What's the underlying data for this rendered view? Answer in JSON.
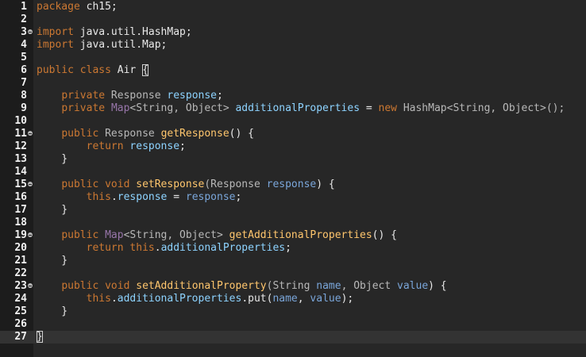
{
  "colors": {
    "background": "#272727",
    "gutter": "#1c1c1c",
    "current_line": "#333333",
    "keyword": "#cc7832",
    "method": "#ffc66d",
    "field": "#8dd3ff",
    "parameter": "#7aa6da",
    "interface_type": "#9876aa"
  },
  "fold_icon": "fold-collapse-icon",
  "current_line": 27,
  "lines": [
    {
      "num": "1",
      "fold": false,
      "tokens": [
        {
          "t": "package",
          "c": "kw"
        },
        {
          "t": " ch15;",
          "c": "plain"
        }
      ]
    },
    {
      "num": "2",
      "fold": false,
      "tokens": []
    },
    {
      "num": "3",
      "fold": true,
      "tokens": [
        {
          "t": "import",
          "c": "kw"
        },
        {
          "t": " java.util.HashMap;",
          "c": "plain"
        }
      ]
    },
    {
      "num": "4",
      "fold": false,
      "tokens": [
        {
          "t": "import",
          "c": "kw"
        },
        {
          "t": " java.util.Map;",
          "c": "plain"
        }
      ]
    },
    {
      "num": "5",
      "fold": false,
      "tokens": []
    },
    {
      "num": "6",
      "fold": false,
      "tokens": [
        {
          "t": "public",
          "c": "kw"
        },
        {
          "t": " ",
          "c": "plain"
        },
        {
          "t": "class",
          "c": "kw"
        },
        {
          "t": " Air ",
          "c": "plain"
        },
        {
          "t": "{",
          "c": "bracket"
        }
      ]
    },
    {
      "num": "7",
      "fold": false,
      "tokens": []
    },
    {
      "num": "8",
      "fold": false,
      "tokens": [
        {
          "t": "    ",
          "c": "plain"
        },
        {
          "t": "private",
          "c": "kw"
        },
        {
          "t": " Response ",
          "c": "type"
        },
        {
          "t": "response",
          "c": "field"
        },
        {
          "t": ";",
          "c": "plain"
        }
      ]
    },
    {
      "num": "9",
      "fold": false,
      "tokens": [
        {
          "t": "    ",
          "c": "plain"
        },
        {
          "t": "private",
          "c": "kw"
        },
        {
          "t": " ",
          "c": "plain"
        },
        {
          "t": "Map",
          "c": "iface"
        },
        {
          "t": "<String, Object> ",
          "c": "type"
        },
        {
          "t": "additionalProperties",
          "c": "field"
        },
        {
          "t": " = ",
          "c": "plain"
        },
        {
          "t": "new",
          "c": "kw"
        },
        {
          "t": " HashMap<String, Object>();",
          "c": "type"
        }
      ]
    },
    {
      "num": "10",
      "fold": false,
      "tokens": []
    },
    {
      "num": "11",
      "fold": true,
      "tokens": [
        {
          "t": "    ",
          "c": "plain"
        },
        {
          "t": "public",
          "c": "kw"
        },
        {
          "t": " Response ",
          "c": "type"
        },
        {
          "t": "getResponse",
          "c": "method"
        },
        {
          "t": "() {",
          "c": "plain"
        }
      ]
    },
    {
      "num": "12",
      "fold": false,
      "tokens": [
        {
          "t": "        ",
          "c": "plain"
        },
        {
          "t": "return",
          "c": "kw"
        },
        {
          "t": " ",
          "c": "plain"
        },
        {
          "t": "response",
          "c": "field"
        },
        {
          "t": ";",
          "c": "plain"
        }
      ]
    },
    {
      "num": "13",
      "fold": false,
      "tokens": [
        {
          "t": "    }",
          "c": "plain"
        }
      ]
    },
    {
      "num": "14",
      "fold": false,
      "tokens": []
    },
    {
      "num": "15",
      "fold": true,
      "tokens": [
        {
          "t": "    ",
          "c": "plain"
        },
        {
          "t": "public",
          "c": "kw"
        },
        {
          "t": " ",
          "c": "plain"
        },
        {
          "t": "void",
          "c": "kw"
        },
        {
          "t": " ",
          "c": "plain"
        },
        {
          "t": "setResponse",
          "c": "method"
        },
        {
          "t": "(Response ",
          "c": "type"
        },
        {
          "t": "response",
          "c": "param"
        },
        {
          "t": ") {",
          "c": "plain"
        }
      ]
    },
    {
      "num": "16",
      "fold": false,
      "tokens": [
        {
          "t": "        ",
          "c": "plain"
        },
        {
          "t": "this",
          "c": "kw"
        },
        {
          "t": ".",
          "c": "plain"
        },
        {
          "t": "response",
          "c": "field"
        },
        {
          "t": " = ",
          "c": "plain"
        },
        {
          "t": "response",
          "c": "param"
        },
        {
          "t": ";",
          "c": "plain"
        }
      ]
    },
    {
      "num": "17",
      "fold": false,
      "tokens": [
        {
          "t": "    }",
          "c": "plain"
        }
      ]
    },
    {
      "num": "18",
      "fold": false,
      "tokens": []
    },
    {
      "num": "19",
      "fold": true,
      "tokens": [
        {
          "t": "    ",
          "c": "plain"
        },
        {
          "t": "public",
          "c": "kw"
        },
        {
          "t": " ",
          "c": "plain"
        },
        {
          "t": "Map",
          "c": "iface"
        },
        {
          "t": "<String, Object> ",
          "c": "type"
        },
        {
          "t": "getAdditionalProperties",
          "c": "method"
        },
        {
          "t": "() {",
          "c": "plain"
        }
      ]
    },
    {
      "num": "20",
      "fold": false,
      "tokens": [
        {
          "t": "        ",
          "c": "plain"
        },
        {
          "t": "return",
          "c": "kw"
        },
        {
          "t": " ",
          "c": "plain"
        },
        {
          "t": "this",
          "c": "kw"
        },
        {
          "t": ".",
          "c": "plain"
        },
        {
          "t": "additionalProperties",
          "c": "field"
        },
        {
          "t": ";",
          "c": "plain"
        }
      ]
    },
    {
      "num": "21",
      "fold": false,
      "tokens": [
        {
          "t": "    }",
          "c": "plain"
        }
      ]
    },
    {
      "num": "22",
      "fold": false,
      "tokens": []
    },
    {
      "num": "23",
      "fold": true,
      "tokens": [
        {
          "t": "    ",
          "c": "plain"
        },
        {
          "t": "public",
          "c": "kw"
        },
        {
          "t": " ",
          "c": "plain"
        },
        {
          "t": "void",
          "c": "kw"
        },
        {
          "t": " ",
          "c": "plain"
        },
        {
          "t": "setAdditionalProperty",
          "c": "method"
        },
        {
          "t": "(String ",
          "c": "type"
        },
        {
          "t": "name",
          "c": "param"
        },
        {
          "t": ", Object ",
          "c": "type"
        },
        {
          "t": "value",
          "c": "param"
        },
        {
          "t": ") {",
          "c": "plain"
        }
      ]
    },
    {
      "num": "24",
      "fold": false,
      "tokens": [
        {
          "t": "        ",
          "c": "plain"
        },
        {
          "t": "this",
          "c": "kw"
        },
        {
          "t": ".",
          "c": "plain"
        },
        {
          "t": "additionalProperties",
          "c": "field"
        },
        {
          "t": ".put(",
          "c": "plain"
        },
        {
          "t": "name",
          "c": "param"
        },
        {
          "t": ", ",
          "c": "plain"
        },
        {
          "t": "value",
          "c": "param"
        },
        {
          "t": ");",
          "c": "plain"
        }
      ]
    },
    {
      "num": "25",
      "fold": false,
      "tokens": [
        {
          "t": "    }",
          "c": "plain"
        }
      ]
    },
    {
      "num": "26",
      "fold": false,
      "tokens": []
    },
    {
      "num": "27",
      "fold": false,
      "tokens": [
        {
          "t": "}",
          "c": "bracket"
        }
      ]
    }
  ]
}
